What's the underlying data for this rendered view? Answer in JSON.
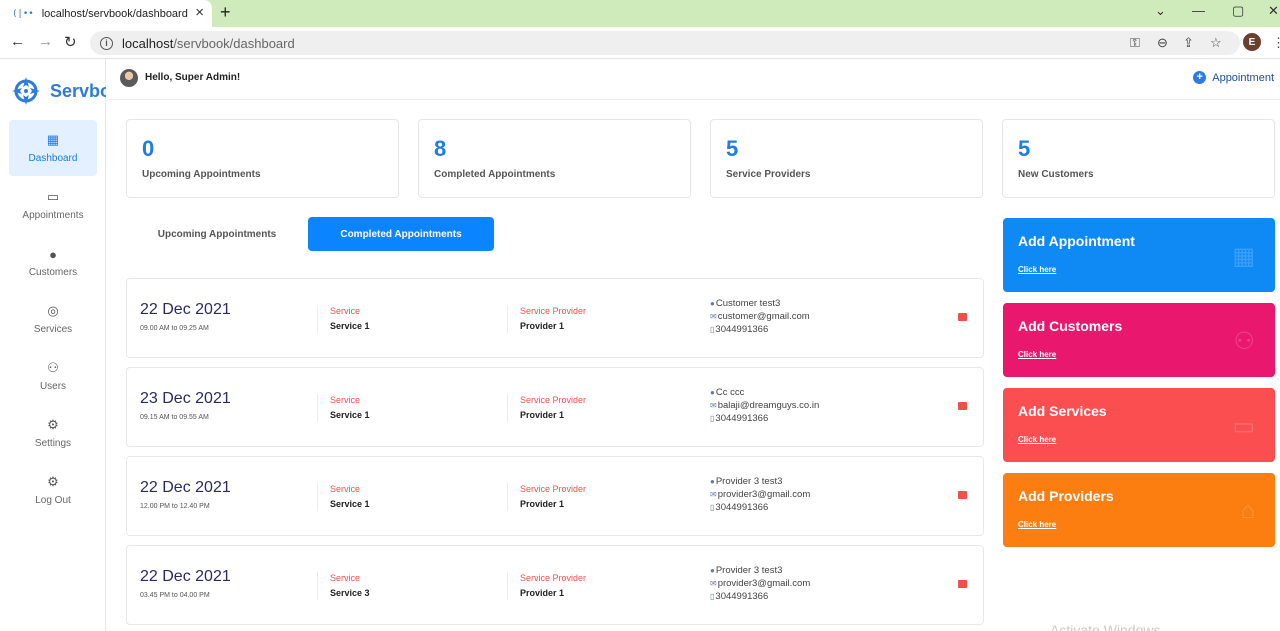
{
  "browser": {
    "tab_title": "localhost/servbook/dashboard",
    "tab_favicon": "(|••",
    "url_host": "localhost",
    "url_path": "/servbook/dashboard",
    "profile_initial": "E"
  },
  "sidebar": {
    "brand": "Servbo",
    "items": [
      {
        "label": "Dashboard",
        "icon": "▦"
      },
      {
        "label": "Appointments",
        "icon": "▭"
      },
      {
        "label": "Customers",
        "icon": "●"
      },
      {
        "label": "Services",
        "icon": "◎"
      },
      {
        "label": "Users",
        "icon": "⚇"
      },
      {
        "label": "Settings",
        "icon": "⚙"
      },
      {
        "label": "Log Out",
        "icon": "⚙"
      }
    ]
  },
  "header": {
    "greeting": "Hello, Super Admin!",
    "appointment_link": "Appointment"
  },
  "stats": [
    {
      "value": "0",
      "label": "Upcoming Appointments"
    },
    {
      "value": "8",
      "label": "Completed Appointments"
    },
    {
      "value": "5",
      "label": "Service Providers"
    },
    {
      "value": "5",
      "label": "New Customers"
    }
  ],
  "tabs": {
    "upcoming": "Upcoming Appointments",
    "completed": "Completed Appointments"
  },
  "appointments": [
    {
      "date": "22 Dec 2021",
      "time": "09.00 AM to 09.25 AM",
      "service_label": "Service",
      "service": "Service 1",
      "provider_label": "Service Provider",
      "provider": "Provider 1",
      "name": "Customer test3",
      "email": "customer@gmail.com",
      "phone": "3044991366"
    },
    {
      "date": "23 Dec 2021",
      "time": "09.15 AM to 09.55 AM",
      "service_label": "Service",
      "service": "Service 1",
      "provider_label": "Service Provider",
      "provider": "Provider 1",
      "name": "Cc ccc",
      "email": "balaji@dreamguys.co.in",
      "phone": "3044991366"
    },
    {
      "date": "22 Dec 2021",
      "time": "12.00 PM to 12.40 PM",
      "service_label": "Service",
      "service": "Service 1",
      "provider_label": "Service Provider",
      "provider": "Provider 1",
      "name": "Provider 3 test3",
      "email": "provider3@gmail.com",
      "phone": "3044991366"
    },
    {
      "date": "22 Dec 2021",
      "time": "03.45 PM to 04.00 PM",
      "service_label": "Service",
      "service": "Service 3",
      "provider_label": "Service Provider",
      "provider": "Provider 1",
      "name": "Provider 3 test3",
      "email": "provider3@gmail.com",
      "phone": "3044991366"
    }
  ],
  "actions": [
    {
      "title": "Add Appointment",
      "link": "Click here",
      "color": "#0f8af5"
    },
    {
      "title": "Add Customers",
      "link": "Click here",
      "color": "#ea176f"
    },
    {
      "title": "Add Services",
      "link": "Click here",
      "color": "#fb4e50"
    },
    {
      "title": "Add Providers",
      "link": "Click here",
      "color": "#fd7e10"
    }
  ],
  "watermark": "Activate Windows"
}
